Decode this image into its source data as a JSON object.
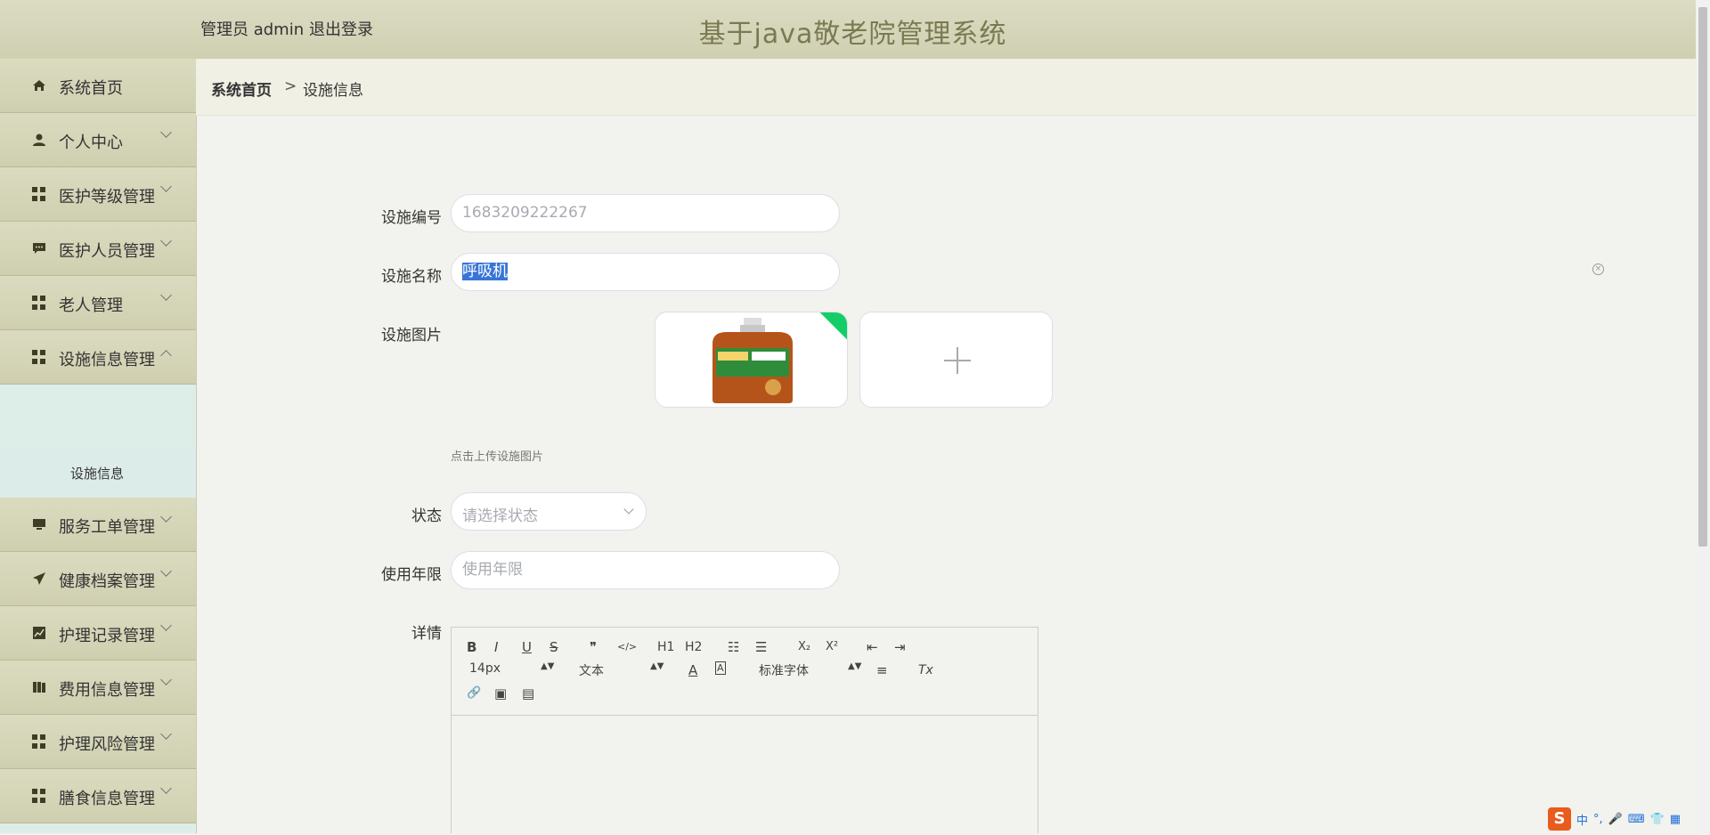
{
  "header": {
    "user_label": "管理员 admin",
    "logout_label": "退出登录",
    "system_title": "基于java敬老院管理系统"
  },
  "sidebar": {
    "items": [
      {
        "label": "系统首页",
        "icon": "home-icon"
      },
      {
        "label": "个人中心",
        "icon": "user-icon"
      },
      {
        "label": "医护等级管理",
        "icon": "grid-icon"
      },
      {
        "label": "医护人员管理",
        "icon": "chat-icon"
      },
      {
        "label": "老人管理",
        "icon": "grid-icon"
      },
      {
        "label": "设施信息管理",
        "icon": "grid-icon",
        "expanded": true
      },
      {
        "label": "服务工单管理",
        "icon": "monitor-icon"
      },
      {
        "label": "健康档案管理",
        "icon": "send-icon"
      },
      {
        "label": "护理记录管理",
        "icon": "chart-icon"
      },
      {
        "label": "费用信息管理",
        "icon": "book-icon"
      },
      {
        "label": "护理风险管理",
        "icon": "grid-icon"
      },
      {
        "label": "膳食信息管理",
        "icon": "grid-icon"
      }
    ],
    "submenu": {
      "label": "设施信息",
      "active": true
    }
  },
  "breadcrumb": {
    "home": "系统首页",
    "separator": ">",
    "current": "设施信息"
  },
  "form": {
    "code_label": "设施编号",
    "code_value": "1683209222267",
    "name_label": "设施名称",
    "name_value": "呼吸机",
    "image_label": "设施图片",
    "image_tip": "点击上传设施图片",
    "status_label": "状态",
    "status_placeholder": "请选择状态",
    "years_label": "使用年限",
    "years_placeholder": "使用年限",
    "detail_label": "详情"
  },
  "editor": {
    "toolbar": {
      "bold": "B",
      "italic": "I",
      "underline": "U",
      "strike": "S",
      "quote": "❞",
      "code": "</>",
      "h1": "H1",
      "h2": "H2",
      "ordered_list": "☷",
      "bullet_list": "☰",
      "subscript": "X₂",
      "superscript": "X²",
      "outdent": "⇤",
      "indent": "⇥",
      "size_value": "14px",
      "header_value": "文本",
      "font_color": "A",
      "bg_color": "A",
      "font_value": "标准字体",
      "align": "≡",
      "clean": "Tx",
      "link": "🔗",
      "image": "▣",
      "video": "▤"
    }
  },
  "colors": {
    "header_bg": "#d5d5b8",
    "sidebar_item_bg": "#d6d6b9",
    "sidebar_active_bg": "#dcece8",
    "selection_bg": "#3875d7",
    "upload_badge": "#13ce66"
  },
  "ime": {
    "brand": "S",
    "lang": "中"
  }
}
